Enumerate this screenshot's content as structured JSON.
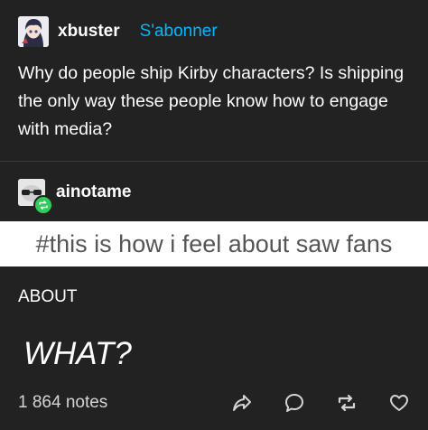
{
  "post": {
    "author": "xbuster",
    "follow_label": "S'abonner",
    "text": "Why do people ship Kirby characters? Is shipping the only way these people know how to engage with media?"
  },
  "reblog": {
    "author": "ainotame",
    "banner_text": "#this is how i feel about saw fans",
    "about_text": "ABOUT",
    "reaction_text": "WHAT?"
  },
  "footer": {
    "notes": "1 864 notes"
  },
  "icons": {
    "share": "share-icon",
    "reply": "reply-icon",
    "reblog": "reblog-icon",
    "like": "heart-icon"
  },
  "colors": {
    "background": "#222222",
    "follow": "#00b8ff",
    "reblog_badge": "#2fcc5a",
    "banner_bg": "#ffffff",
    "banner_text": "#555555"
  }
}
